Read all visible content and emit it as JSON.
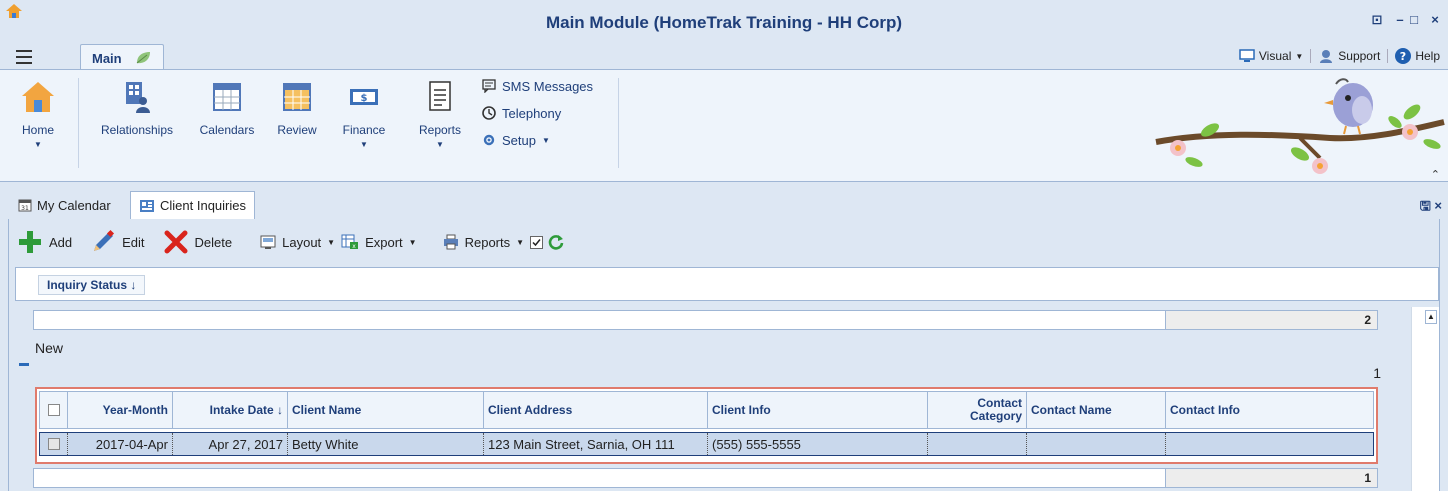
{
  "window": {
    "title": "Main Module (HomeTrak Training - HH Corp)",
    "controls": [
      "⊡",
      "–",
      "□",
      "×"
    ]
  },
  "ribbon": {
    "tab_label": "Main",
    "top_right": {
      "visual_label": "Visual",
      "support_label": "Support",
      "help_label": "Help"
    },
    "buttons": [
      {
        "label": "Home"
      },
      {
        "label": "Relationships"
      },
      {
        "label": "Calendars"
      },
      {
        "label": "Review"
      },
      {
        "label": "Finance"
      },
      {
        "label": "Reports"
      }
    ],
    "small_items": [
      {
        "label": "SMS Messages"
      },
      {
        "label": "Telephony"
      },
      {
        "label": "Setup"
      }
    ]
  },
  "doc_tabs": [
    {
      "label": "My Calendar"
    },
    {
      "label": "Client Inquiries"
    }
  ],
  "toolbar": {
    "add_label": "Add",
    "edit_label": "Edit",
    "delete_label": "Delete",
    "layout_label": "Layout",
    "export_label": "Export",
    "reports_label": "Reports"
  },
  "grouping": {
    "chip_label": "Inquiry Status ↓"
  },
  "grid": {
    "top_total": "2",
    "group_name": "New",
    "group_count": "1",
    "columns": [
      "Year-Month",
      "Intake Date ↓",
      "Client Name",
      "Client Address",
      "Client Info",
      "Contact Category",
      "Contact Name",
      "Contact Info"
    ],
    "rows": [
      {
        "year_month": "2017-04-Apr",
        "intake_date": "Apr 27, 2017",
        "client_name": "Betty White",
        "client_address": "123 Main Street, Sarnia, OH  111",
        "client_info": "(555) 555-5555",
        "contact_category": "",
        "contact_name": "",
        "contact_info": ""
      }
    ],
    "footer_total": "1"
  },
  "colors": {
    "title_blue": "#1f3f7a",
    "highlight_border": "#e07b6c",
    "selected_row": "#c9d8ec",
    "add_green": "#2e9b3a",
    "delete_red": "#d9241c"
  }
}
